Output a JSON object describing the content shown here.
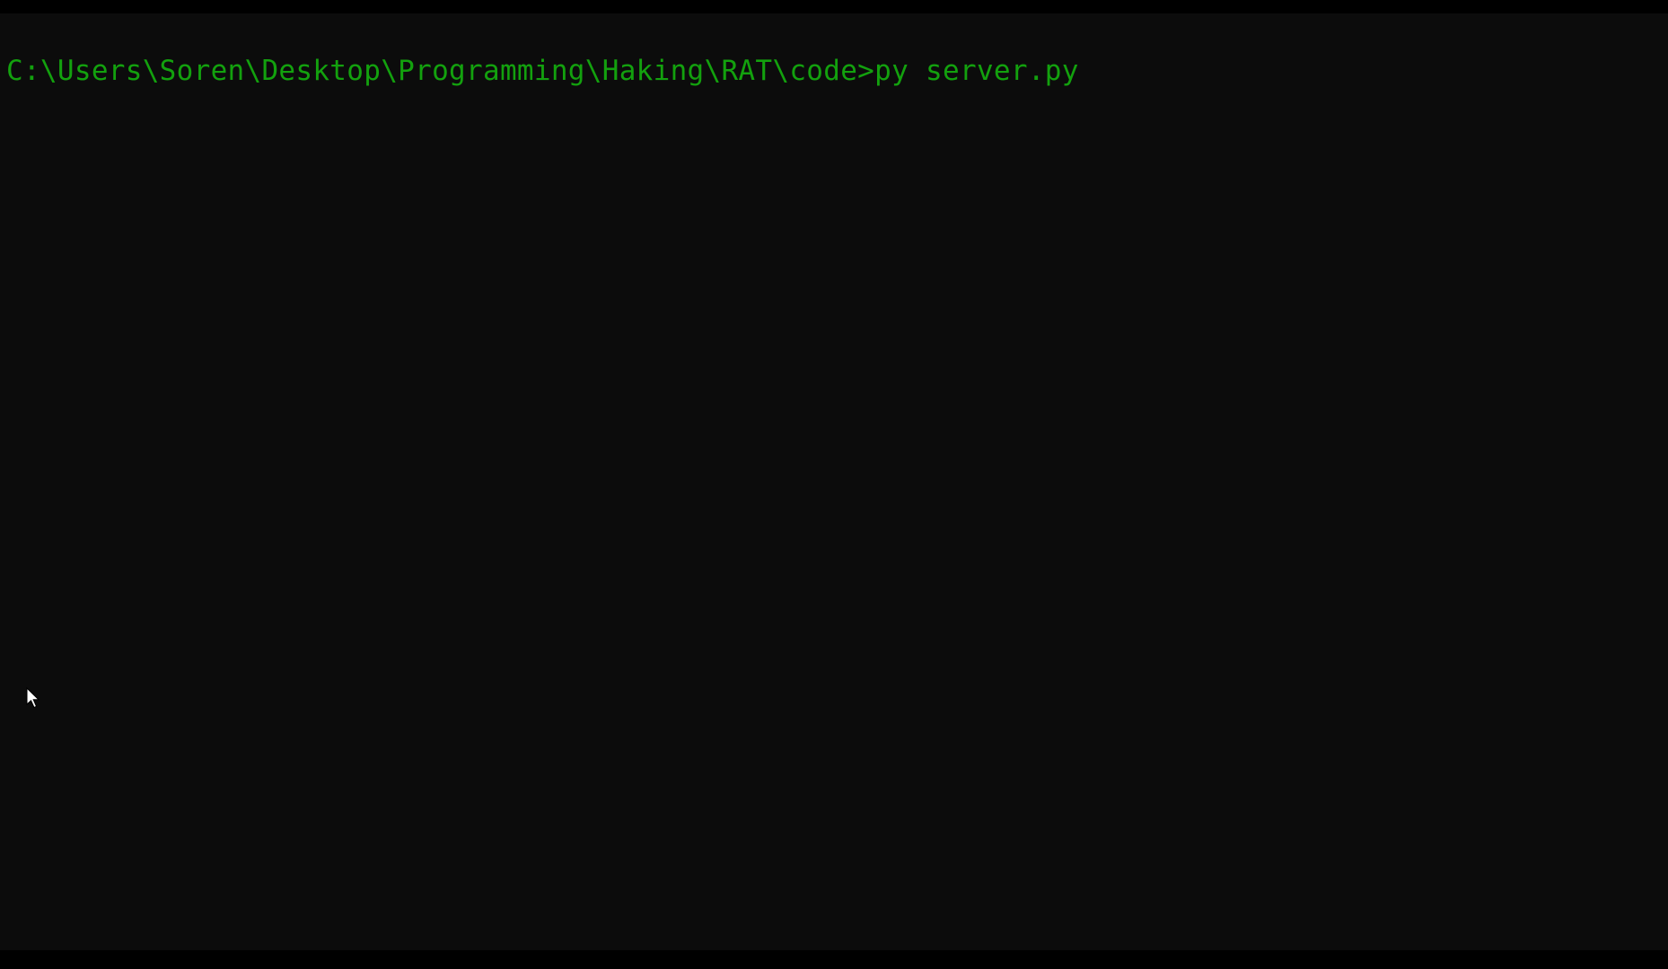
{
  "terminal": {
    "prompt": "C:\\Users\\Soren\\Desktop\\Programming\\Haking\\RAT\\code>",
    "command": "py server.py"
  },
  "colors": {
    "background": "#0c0c0c",
    "letterbox": "#000000",
    "text": "#13a10e"
  },
  "icons": {
    "cursor": "mouse-pointer-icon"
  }
}
